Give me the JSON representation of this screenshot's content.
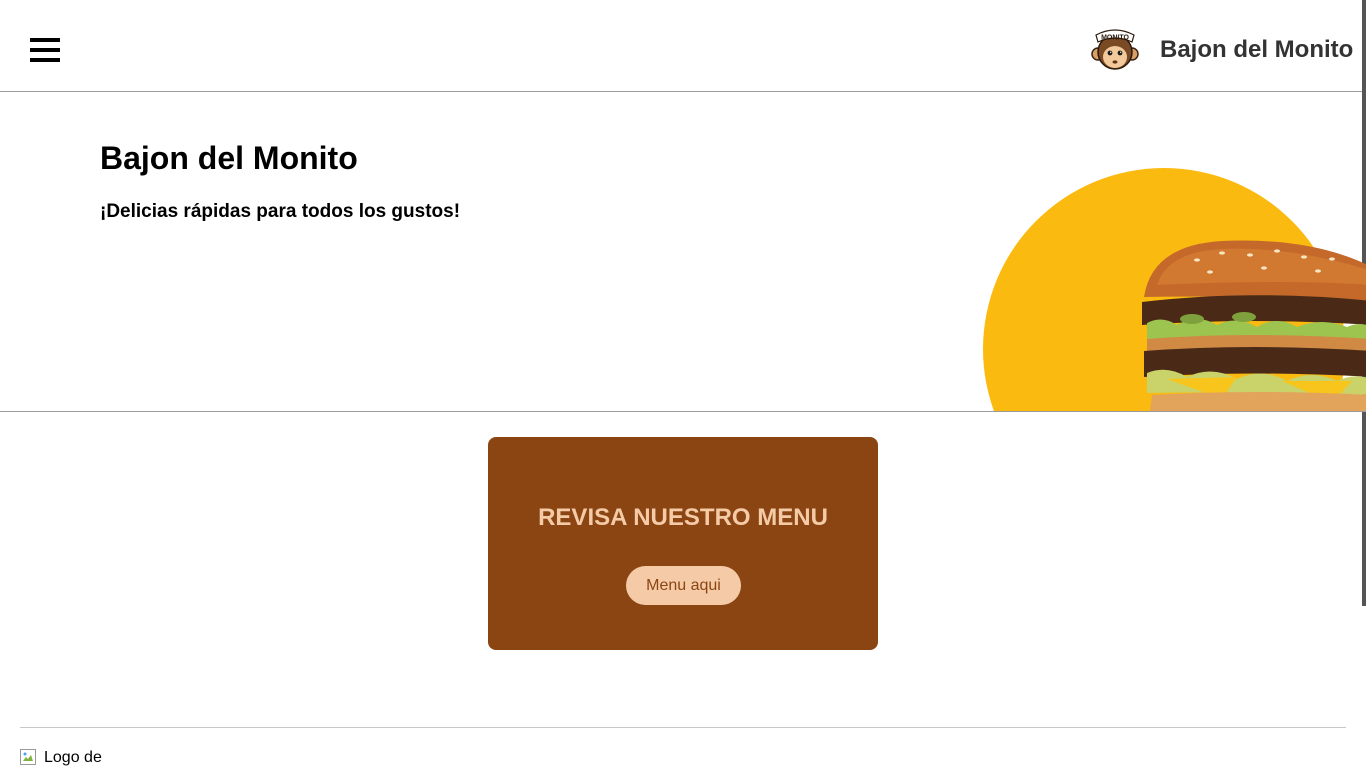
{
  "header": {
    "brand_name": "Bajon del Monito",
    "logo_text": "MONITO",
    "menu_icon": "hamburger-menu-icon"
  },
  "hero": {
    "title": "Bajon del Monito",
    "subtitle": "¡Delicias rápidas para todos los gustos!",
    "image": "burger-illustration",
    "circle_color": "#fbba0f"
  },
  "menu_card": {
    "title": "REVISA NUESTRO MENU",
    "button_label": "Menu aqui",
    "background_color": "#8b4513",
    "accent_color": "#f5cba7"
  },
  "footer": {
    "logo_alt": "Logo de",
    "logo_icon": "broken-image-icon"
  }
}
